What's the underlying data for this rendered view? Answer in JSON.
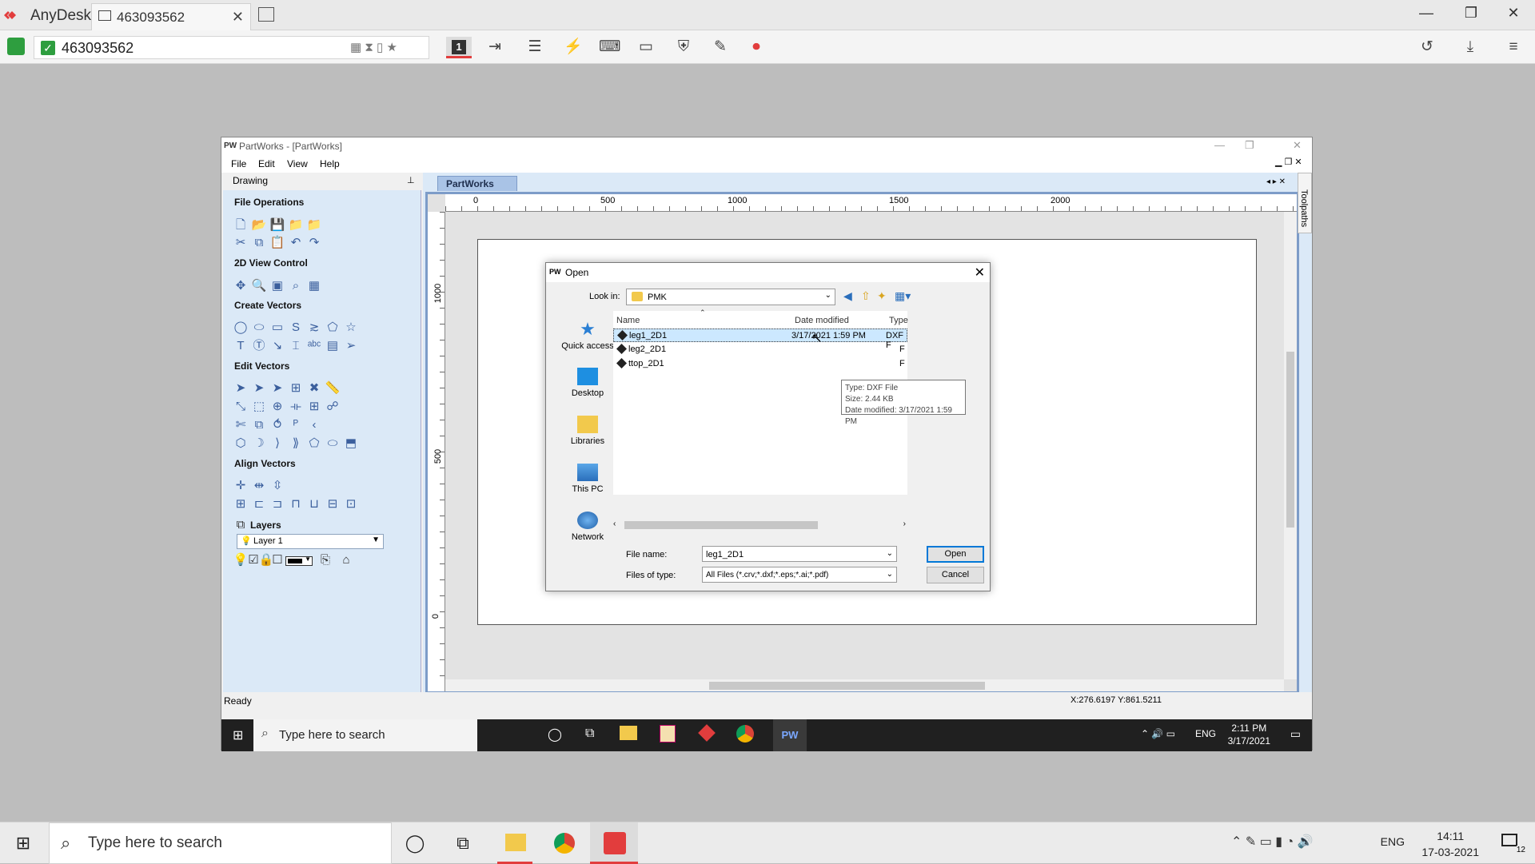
{
  "anydesk": {
    "brand": "AnyDesk",
    "tab_label": "463093562",
    "address_value": "463093562",
    "monitor_number": "1",
    "accent": "#e23d3d"
  },
  "partworks": {
    "title": "PartWorks - [PartWorks]",
    "title_icon": "PW",
    "menu": [
      "File",
      "Edit",
      "View",
      "Help"
    ],
    "panel_header": "Drawing",
    "sections": {
      "file_ops": "File Operations",
      "view_ctrl": "2D View Control",
      "create": "Create Vectors",
      "edit": "Edit Vectors",
      "align": "Align Vectors",
      "layers": "Layers"
    },
    "layer_selected": "Layer 1",
    "doc_tab": "PartWorks",
    "ruler_top": [
      "0",
      "500",
      "1000",
      "1500",
      "2000"
    ],
    "ruler_left": [
      "1000",
      "500",
      "0"
    ],
    "side_tab": "Toolpaths",
    "status": "Ready",
    "coords": "X:276.6197 Y:861.5211"
  },
  "dialog": {
    "title": "Open",
    "title_icon": "PW",
    "look_in_label": "Look in:",
    "look_in_value": "PMK",
    "places": [
      "Quick access",
      "Desktop",
      "Libraries",
      "This PC",
      "Network"
    ],
    "columns": {
      "name": "Name",
      "date": "Date modified",
      "type": "Type"
    },
    "files": [
      {
        "name": "leg1_2D1",
        "date": "3/17/2021 1:59 PM",
        "type": "DXF F"
      },
      {
        "name": "leg2_2D1",
        "date": "",
        "type": "F"
      },
      {
        "name": "ttop_2D1",
        "date": "",
        "type": "F"
      }
    ],
    "tooltip": {
      "type": "Type: DXF File",
      "size": "Size: 2.44 KB",
      "date": "Date modified: 3/17/2021 1:59 PM"
    },
    "file_name_label": "File name:",
    "file_name_value": "leg1_2D1",
    "file_type_label": "Files of type:",
    "file_type_value": "All Files (*.crv;*.dxf;*.eps;*.ai;*.pdf)",
    "open_button": "Open",
    "cancel_button": "Cancel"
  },
  "remote_taskbar": {
    "search_placeholder": "Type here to search",
    "lang": "ENG",
    "time": "2:11 PM",
    "date": "3/17/2021",
    "pw_label": "PW"
  },
  "host_taskbar": {
    "search_placeholder": "Type here to search",
    "lang": "ENG",
    "time": "14:11",
    "date": "17-03-2021",
    "notifications": "12"
  }
}
